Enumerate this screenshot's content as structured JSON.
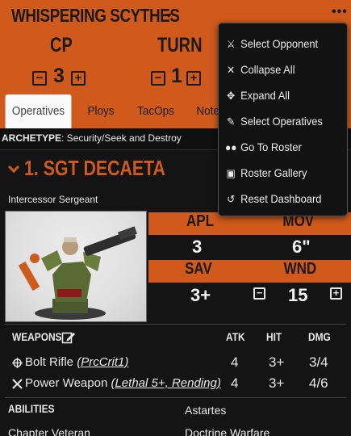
{
  "header": {
    "team_name": "WHISPERING SCYTHES",
    "cp_label": "CP",
    "cp_value": "3",
    "turn_label": "TURN",
    "turn_value": "1",
    "kebab": "•••"
  },
  "tabs": [
    "Operatives",
    "Ploys",
    "TacOps",
    "Notes"
  ],
  "active_tab": "Operatives",
  "archetype": {
    "label": "ARCHETYPE",
    "value": ": Security/Seek and Destroy"
  },
  "operative": {
    "name": "1. SGT DECAETA",
    "type": "Intercessor Sergeant",
    "stats": {
      "apl_label": "APL",
      "apl": "3",
      "mov_label": "MOV",
      "mov": "6\"",
      "sav_label": "SAV",
      "sav": "3+",
      "wnd_label": "WND",
      "wnd": "15"
    },
    "weapons_label": "WEAPONS",
    "weapon_headers": [
      "ATK",
      "HIT",
      "DMG"
    ],
    "weapons": [
      {
        "icon": "crosshair-icon",
        "name": "Bolt Rifle",
        "rule": "(PrcCrit1)",
        "atk": "4",
        "hit": "3+",
        "dmg": "3/4"
      },
      {
        "icon": "crossed-swords-icon",
        "name": "Power Weapon",
        "rule": "(Lethal 5+, Rending)",
        "atk": "4",
        "hit": "3+",
        "dmg": "4/6"
      }
    ],
    "abilities_label": "ABILITIES",
    "abilities": [
      "Astartes",
      "Chapter Veteran",
      "Doctrine Warfare"
    ]
  },
  "menu": {
    "items": [
      {
        "icon": "select-opponent-icon",
        "label": "Select Opponent"
      },
      {
        "icon": "collapse-all-icon",
        "label": "Collapse All"
      },
      {
        "icon": "expand-all-icon",
        "label": "Expand All"
      },
      {
        "icon": "edit-icon",
        "label": "Select Operatives"
      },
      {
        "icon": "users-icon",
        "label": "Go To Roster"
      },
      {
        "icon": "gallery-icon",
        "label": "Roster Gallery"
      },
      {
        "icon": "reset-icon",
        "label": "Reset Dashboard"
      }
    ]
  },
  "colors": {
    "accent": "#cf5a1c",
    "background": "#101010",
    "text": "#e8e8e8"
  }
}
